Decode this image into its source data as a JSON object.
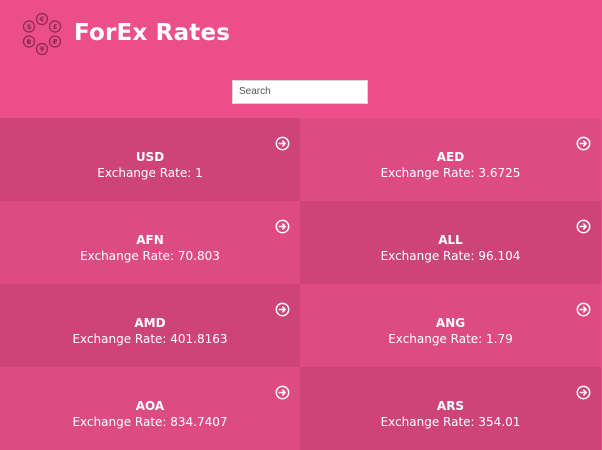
{
  "header": {
    "title": "ForEx Rates",
    "logo_icon": "currency-coins-icon",
    "logo_symbols": [
      "$",
      "€",
      "£",
      "₽",
      "¥",
      "฿"
    ]
  },
  "search": {
    "placeholder": "Search",
    "value": ""
  },
  "colors": {
    "background": "#ec4e8b",
    "card_dark": "#cf4478",
    "card_light": "#de4b84",
    "text": "#ffffff"
  },
  "currencies": [
    {
      "code": "USD",
      "rate_text": "Exchange Rate: 1"
    },
    {
      "code": "AED",
      "rate_text": "Exchange Rate: 3.6725"
    },
    {
      "code": "AFN",
      "rate_text": "Exchange Rate: 70.803"
    },
    {
      "code": "ALL",
      "rate_text": "Exchange Rate: 96.104"
    },
    {
      "code": "AMD",
      "rate_text": "Exchange Rate: 401.8163"
    },
    {
      "code": "ANG",
      "rate_text": "Exchange Rate: 1.79"
    },
    {
      "code": "AOA",
      "rate_text": "Exchange Rate: 834.7407"
    },
    {
      "code": "ARS",
      "rate_text": "Exchange Rate: 354.01"
    }
  ]
}
